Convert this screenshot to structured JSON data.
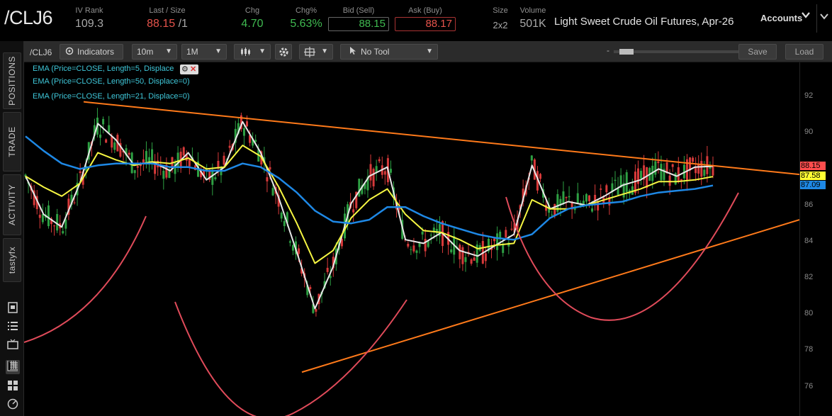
{
  "symbol": "/CLJ6",
  "quote": {
    "iv_rank_label": "IV Rank",
    "iv_rank": "109.3",
    "last_size_label": "Last / Size",
    "last": "88.15",
    "size": "/1",
    "chg_label": "Chg",
    "chg": "4.70",
    "chg_pct_label": "Chg%",
    "chg_pct": "5.63%",
    "bid_label": "Bid (Sell)",
    "bid": "88.15",
    "ask_label": "Ask (Buy)",
    "ask": "88.17",
    "bidask_size_label": "Size",
    "bidask_size": "2x2",
    "volume_label": "Volume",
    "volume": "501K",
    "description": "Light Sweet Crude Oil Futures, Apr-26"
  },
  "accounts": {
    "label": "Accounts",
    "chevron_icon": "chevron-down-icon"
  },
  "sidebar": {
    "tabs": [
      "POSITIONS",
      "TRADE",
      "ACTIVITY",
      "tastyfx"
    ],
    "icons": [
      "notebook-icon",
      "list-icon",
      "monitor-icon",
      "chart-grid-icon",
      "grid-icon",
      "gauge-icon"
    ]
  },
  "toolbar": {
    "symbol": "/CLJ6",
    "indicators_label": "Indicators",
    "interval": "10m",
    "range": "1M",
    "chart_type_icon": "candlestick-icon",
    "settings_icon": "gear-icon",
    "drawing_icon": "crosshair-icon",
    "tool": "No Tool",
    "zoom_minus": "-",
    "zoom_plus": "+",
    "save_label": "Save",
    "load_label": "Load"
  },
  "legend": [
    "EMA (Price=CLOSE, Length=5, Displace",
    "EMA (Price=CLOSE, Length=50, Displace=0)",
    "EMA (Price=CLOSE, Length=21, Displace=0)"
  ],
  "price_tags": [
    {
      "value": "88.15",
      "color": "#ff4d4d"
    },
    {
      "value": "87.58",
      "color": "#ffff33"
    },
    {
      "value": "87.09",
      "color": "#1e88e5"
    }
  ],
  "chart_data": {
    "type": "line",
    "ylim": [
      75,
      93
    ],
    "y_ticks": [
      "92",
      "90",
      "88",
      "86",
      "84",
      "82",
      "80",
      "78",
      "76"
    ],
    "series": [
      {
        "name": "EMA (Price=CLOSE, Length=5, Displace=0)",
        "color": "#e8e8e8",
        "values": [
          87.6,
          85.5,
          84.8,
          87.2,
          90.5,
          89.6,
          88.2,
          88.4,
          87.9,
          88.9,
          87.4,
          88.1,
          90.6,
          88.9,
          86.4,
          83.4,
          80.3,
          82.6,
          86.1,
          87.6,
          88.1,
          84.1,
          83.9,
          84.5,
          83.5,
          83.2,
          83.8,
          84.4,
          88.2,
          85.8,
          86.2,
          86.0,
          86.5,
          87.1,
          87.4,
          88.0,
          87.6,
          88.1,
          88.15
        ]
      },
      {
        "name": "EMA (Price=CLOSE, Length=21, Displace=0)",
        "color": "#f5f542",
        "values": [
          87.6,
          87.0,
          86.5,
          87.2,
          88.9,
          88.5,
          88.2,
          88.4,
          88.3,
          88.6,
          88.0,
          88.1,
          89.3,
          88.7,
          87.0,
          85.0,
          82.8,
          83.5,
          85.3,
          86.3,
          86.9,
          85.5,
          84.6,
          84.5,
          84.1,
          83.6,
          83.8,
          83.9,
          86.3,
          85.8,
          85.8,
          86.0,
          86.3,
          86.6,
          86.9,
          87.3,
          87.3,
          87.4,
          87.58
        ]
      },
      {
        "name": "EMA (Price=CLOSE, Length=50, Displace=0)",
        "color": "#1e88e5",
        "values": [
          89.8,
          89.0,
          88.3,
          88.0,
          88.2,
          88.3,
          88.3,
          88.3,
          88.1,
          88.1,
          87.9,
          87.9,
          88.3,
          88.1,
          87.5,
          86.7,
          85.7,
          85.1,
          85.0,
          85.2,
          85.9,
          85.9,
          85.4,
          85.0,
          84.7,
          84.4,
          84.2,
          84.1,
          84.4,
          85.3,
          85.8,
          86.0,
          86.1,
          86.2,
          86.5,
          86.7,
          86.8,
          86.9,
          87.09
        ]
      }
    ]
  }
}
